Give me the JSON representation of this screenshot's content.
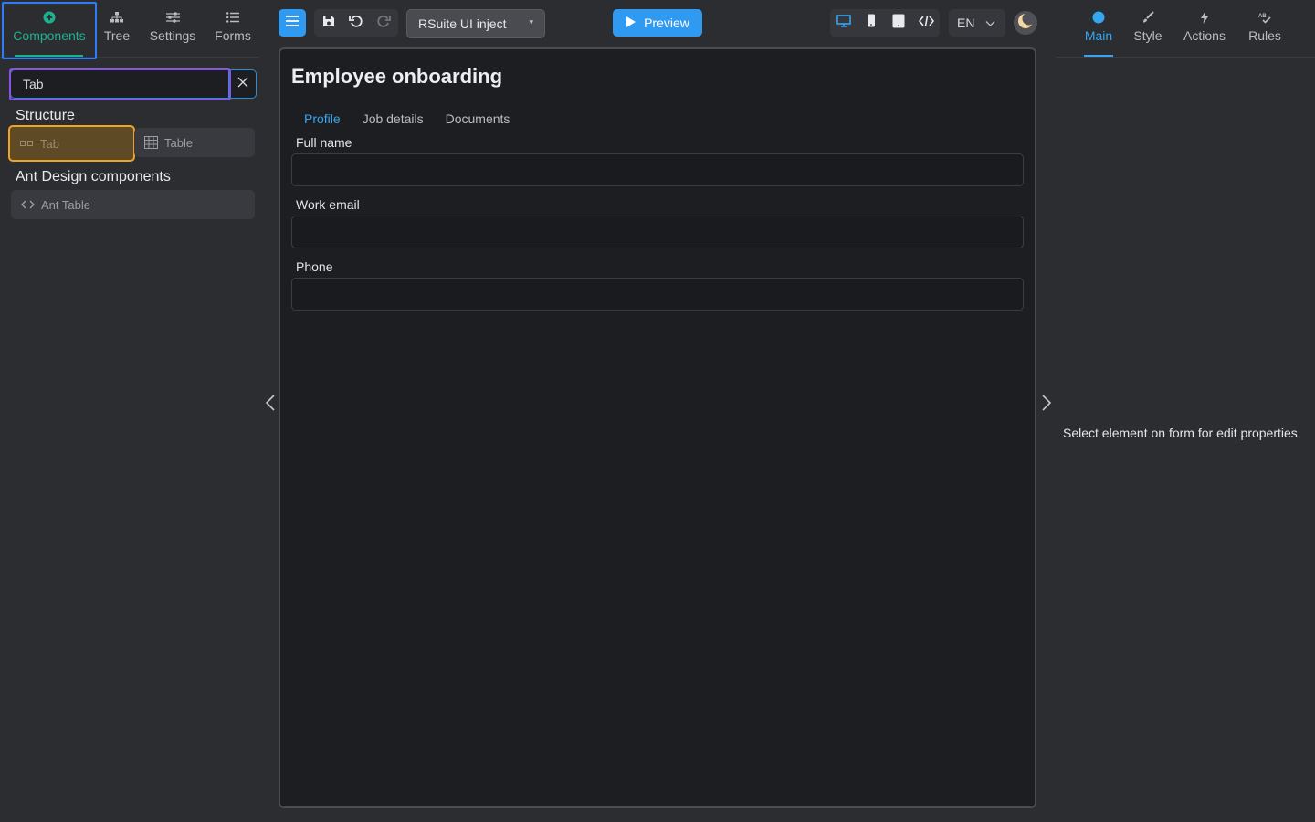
{
  "left_tabs": [
    {
      "label": "Components",
      "icon": "plus-circle-icon"
    },
    {
      "label": "Tree",
      "icon": "tree-icon"
    },
    {
      "label": "Settings",
      "icon": "sliders-icon"
    },
    {
      "label": "Forms",
      "icon": "list-icon"
    }
  ],
  "search": {
    "value": "Tab",
    "placeholder": ""
  },
  "sections": {
    "structure": "Structure",
    "ant": "Ant Design components"
  },
  "components": {
    "tab": "Tab",
    "table": "Table",
    "ant_table": "Ant Table"
  },
  "toolbar": {
    "project": "RSuite UI inject",
    "preview": "Preview",
    "lang": "EN"
  },
  "form": {
    "title": "Employee onboarding",
    "tabs": [
      "Profile",
      "Job details",
      "Documents"
    ],
    "fields": [
      {
        "label": "Full name",
        "value": ""
      },
      {
        "label": "Work email",
        "value": ""
      },
      {
        "label": "Phone",
        "value": ""
      }
    ]
  },
  "right_tabs": [
    {
      "label": "Main",
      "icon": "dot-icon"
    },
    {
      "label": "Style",
      "icon": "brush-icon"
    },
    {
      "label": "Actions",
      "icon": "bolt-icon"
    },
    {
      "label": "Rules",
      "icon": "rules-icon"
    }
  ],
  "properties_empty": "Select element on form for edit properties",
  "colors": {
    "accent_green": "#1eb18f",
    "accent_blue": "#2f9af0",
    "highlight_orange": "#f1a229",
    "highlight_purple": "#8a52e6",
    "outline_blue": "#2f7cf6"
  }
}
